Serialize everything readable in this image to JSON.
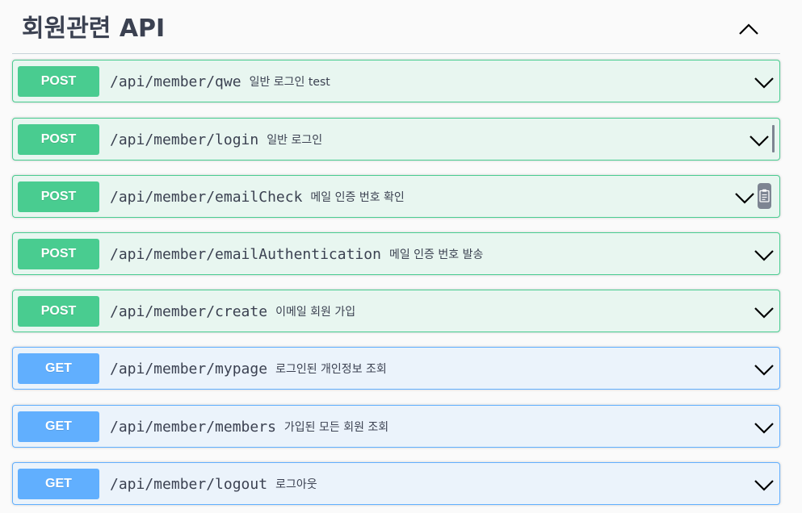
{
  "section": {
    "title": "회원관련 API"
  },
  "colors": {
    "post_accent": "#49cc90",
    "post_background": "#e8f6f0",
    "get_accent": "#61affe",
    "get_background": "#ebf3fb"
  },
  "icons": {
    "collapse": "chevron-up-icon",
    "expand": "chevron-down-icon",
    "copy": "clipboard-icon"
  },
  "operations": [
    {
      "method": "POST",
      "path": "/api/member/qwe",
      "summary": "일반 로그인 test"
    },
    {
      "method": "POST",
      "path": "/api/member/login",
      "summary": "일반 로그인"
    },
    {
      "method": "POST",
      "path": "/api/member/emailCheck",
      "summary": "메일 인증 번호 확인"
    },
    {
      "method": "POST",
      "path": "/api/member/emailAuthentication",
      "summary": "메일 인증 번호 발송"
    },
    {
      "method": "POST",
      "path": "/api/member/create",
      "summary": "이메일 회원 가입"
    },
    {
      "method": "GET",
      "path": "/api/member/mypage",
      "summary": "로그인된 개인정보 조회"
    },
    {
      "method": "GET",
      "path": "/api/member/members",
      "summary": "가입된 모든 회원 조회"
    },
    {
      "method": "GET",
      "path": "/api/member/logout",
      "summary": "로그아웃"
    }
  ]
}
